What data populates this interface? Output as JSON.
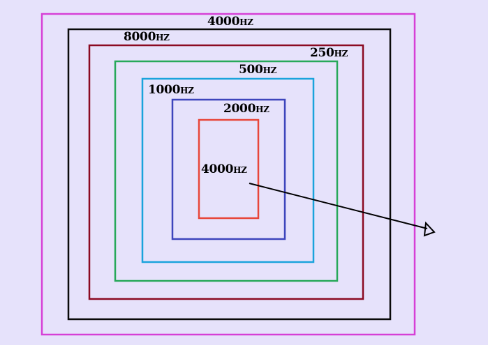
{
  "colors": {
    "background": "#e6e2fb",
    "magenta": "#d640d6",
    "black": "#0a0a0a",
    "maroon": "#8b0a22",
    "green": "#27a85a",
    "cyan": "#1aa3dc",
    "blue": "#3d45bc",
    "red": "#e8463a",
    "arrow": "#000000"
  },
  "labels": {
    "magenta_box": "4000hz",
    "black_box": "8000hz",
    "maroon_box": "250hz",
    "green_box": "500hz",
    "cyan_box": "1000hz",
    "blue_box": "2000hz",
    "red_box": "4000hz"
  }
}
